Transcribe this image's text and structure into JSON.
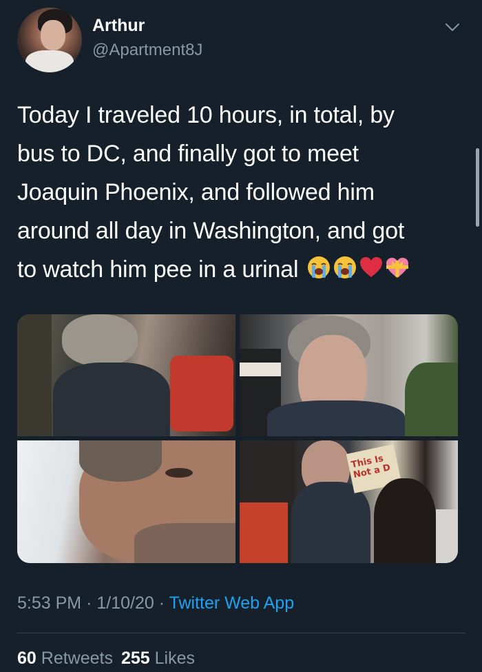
{
  "author": {
    "name": "Arthur",
    "handle": "@Apartment8J",
    "avatar_icon": "profile-avatar"
  },
  "tweet": {
    "lines": [
      "Today I traveled 10 hours, in total, by",
      "bus to DC, and finally got to meet",
      "Joaquin Phoenix, and followed him",
      "around all day in Washington, and got",
      "to watch him pee in a urinal"
    ],
    "emojis": [
      "loudly-crying-face",
      "loudly-crying-face",
      "red-heart",
      "heart-with-ribbon"
    ]
  },
  "media": {
    "photos": [
      {
        "name": "photo-man-seated-from-behind"
      },
      {
        "name": "photo-man-closeup-gray-hair"
      },
      {
        "name": "photo-face-selfie-closeup"
      },
      {
        "name": "photo-crowd-with-sign",
        "sign_text": "This Is Not a D"
      }
    ]
  },
  "meta": {
    "time": "5:53 PM",
    "separator": "·",
    "date": "1/10/20",
    "source": "Twitter Web App"
  },
  "stats": {
    "retweets_count": "60",
    "retweets_label": "Retweets",
    "likes_count": "255",
    "likes_label": "Likes"
  },
  "colors": {
    "background": "#15202b",
    "text": "#ffffff",
    "secondary_text": "#8899a6",
    "link": "#1da1f2",
    "divider": "#38444d"
  }
}
